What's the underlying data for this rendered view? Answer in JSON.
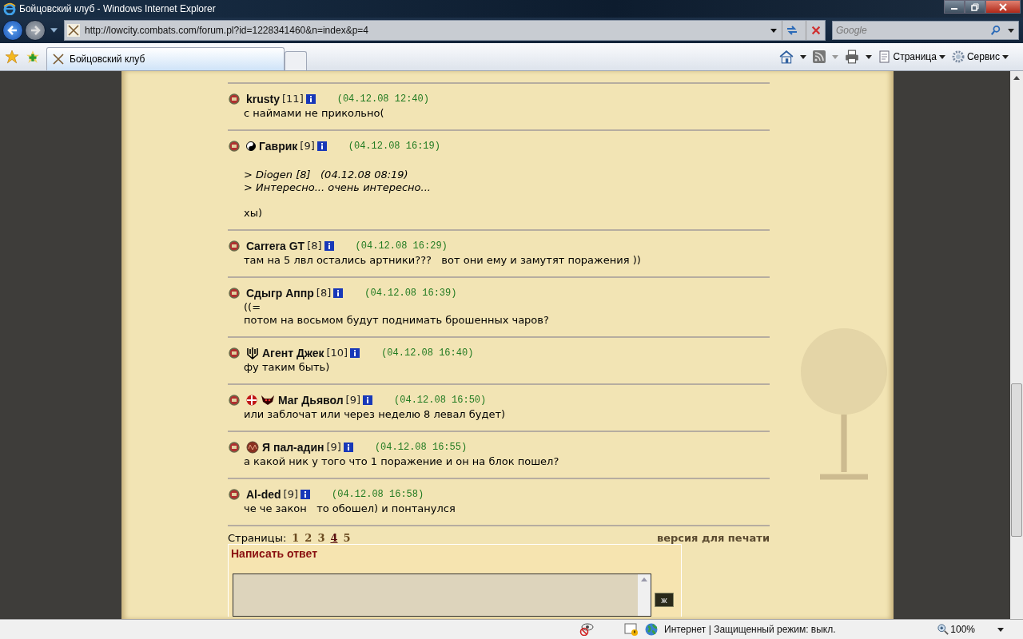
{
  "window": {
    "title": "Бойцовский клуб - Windows Internet Explorer"
  },
  "address": {
    "url": "http://lowcity.combats.com/forum.pl?id=1228341460&n=index&p=4"
  },
  "search": {
    "placeholder": "Google"
  },
  "tabs": [
    {
      "label": "Бойцовский клуб",
      "selected": true
    }
  ],
  "toolbar": {
    "page_menu": "Страница",
    "tools_menu": "Сервис"
  },
  "posts": [
    {
      "author": "krusty",
      "level": "[11]",
      "date": "(04.12.08 12:40)",
      "lines": [
        "с наймами не прикольно("
      ]
    },
    {
      "author": "Гаврик",
      "level": "[9]",
      "date": "(04.12.08 16:19)",
      "emblems": [
        {
          "kind": "yinyang"
        }
      ],
      "quote": [
        "> Diogen [8]   (04.12.08 08:19)",
        "> Интересно... очень интересно..."
      ],
      "lines": [
        "хы)"
      ]
    },
    {
      "author": "Carrera GT",
      "level": "[8]",
      "date": "(04.12.08 16:29)",
      "lines": [
        "там на 5 лвл остались артники???   вот они ему и замутят поражения ))"
      ]
    },
    {
      "author": "Сдыгр Аппр",
      "level": "[8]",
      "date": "(04.12.08 16:39)",
      "lines": [
        "((=",
        "потом на восьмом будут поднимать брошенных чаров?"
      ]
    },
    {
      "author": "Агент Джек",
      "level": "[10]",
      "date": "(04.12.08 16:40)",
      "emblems": [
        {
          "kind": "trident"
        }
      ],
      "lines": [
        "фу таким быть)"
      ]
    },
    {
      "author": "Маг Дьявол",
      "level": "[9]",
      "date": "(04.12.08 16:50)",
      "emblems": [
        {
          "kind": "cross"
        },
        {
          "kind": "demon"
        }
      ],
      "lines": [
        "или заблочат или через неделю 8 левал будет)"
      ]
    },
    {
      "author": "Я пал-адин",
      "level": "[9]",
      "date": "(04.12.08 16:55)",
      "emblems": [
        {
          "kind": "medal"
        }
      ],
      "lines": [
        "а какой ник у того что 1 поражение и он на блок пошел?"
      ]
    },
    {
      "author": "Al-ded",
      "level": "[9]",
      "date": "(04.12.08 16:58)",
      "lines": [
        "че че закон   то обошел) и понтанулся"
      ]
    }
  ],
  "pager": {
    "label": "Страницы:",
    "pages": [
      {
        "label": "1",
        "selected": false
      },
      {
        "label": "2",
        "selected": false
      },
      {
        "label": "3",
        "selected": false
      },
      {
        "label": "4",
        "selected": true
      },
      {
        "label": "5",
        "selected": false
      }
    ],
    "print_link": "версия для печати"
  },
  "reply": {
    "title": "Написать ответ",
    "bold_button": "ж"
  },
  "status_bar": {
    "zone": "Интернет | Защищенный режим: выкл.",
    "zoom": "100%"
  }
}
